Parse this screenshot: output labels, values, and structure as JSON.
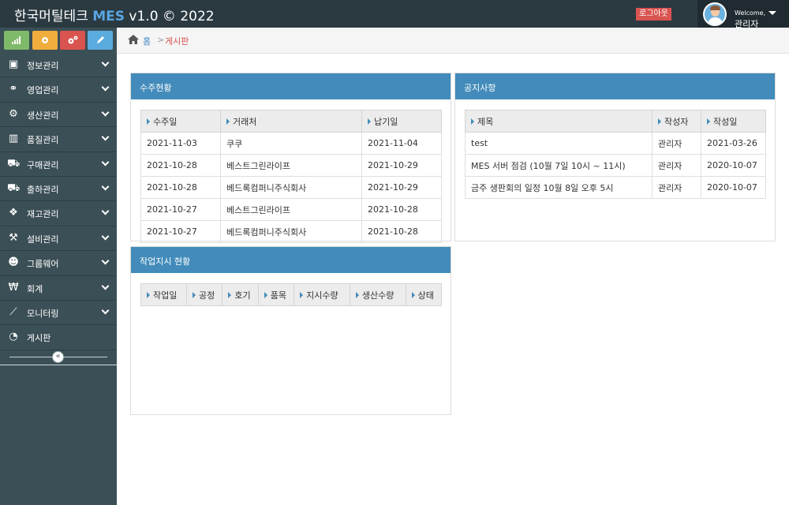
{
  "header": {
    "brand_prefix": "한국머틸테크 ",
    "brand_mes": "MES",
    "brand_suffix": " v1.0 © 2022",
    "logout_label": "로그아웃",
    "welcome": "Welcome,",
    "username": "관리자"
  },
  "shortcuts": [
    {
      "icon": "signal-icon",
      "color": "#7fba6a"
    },
    {
      "icon": "gear-icon",
      "color": "#f0ad3c"
    },
    {
      "icon": "cogs-icon",
      "color": "#d9534f"
    },
    {
      "icon": "pencil-icon",
      "color": "#5bacde"
    }
  ],
  "sidebar": {
    "items": [
      {
        "label": "정보관리",
        "icon": "contact-card-icon",
        "has_children": true
      },
      {
        "label": "영업관리",
        "icon": "handshake-icon",
        "has_children": true
      },
      {
        "label": "생산관리",
        "icon": "cogs-icon",
        "has_children": true
      },
      {
        "label": "품질관리",
        "icon": "barcode-icon",
        "has_children": true
      },
      {
        "label": "구매관리",
        "icon": "shopping-cart-icon",
        "has_children": true
      },
      {
        "label": "출하관리",
        "icon": "truck-icon",
        "has_children": true
      },
      {
        "label": "재고관리",
        "icon": "cubes-icon",
        "has_children": true
      },
      {
        "label": "설비관리",
        "icon": "wrench-icon",
        "has_children": true
      },
      {
        "label": "그룹웨어",
        "icon": "users-icon",
        "has_children": true
      },
      {
        "label": "회계",
        "icon": "won-icon",
        "has_children": true
      },
      {
        "label": "모니터링",
        "icon": "line-chart-icon",
        "has_children": true
      },
      {
        "label": "게시판",
        "icon": "dashboard-icon",
        "has_children": false
      }
    ],
    "collapse_glyph": "«"
  },
  "breadcrumb": {
    "home": "홈",
    "separator": ">",
    "current": "게시판"
  },
  "orders_panel": {
    "title": "수주현황",
    "columns": [
      "수주일",
      "거래처",
      "납기일"
    ],
    "rows": [
      [
        "2021-11-03",
        "쿠쿠",
        "2021-11-04"
      ],
      [
        "2021-10-28",
        "베스트그린라이프",
        "2021-10-29"
      ],
      [
        "2021-10-28",
        "베드록컴퍼니주식회사",
        "2021-10-29"
      ],
      [
        "2021-10-27",
        "베스트그린라이프",
        "2021-10-28"
      ],
      [
        "2021-10-27",
        "베드록컴퍼니주식회사",
        "2021-10-28"
      ]
    ]
  },
  "notice_panel": {
    "title": "공지사항",
    "columns": [
      "제목",
      "작성자",
      "작성일"
    ],
    "rows": [
      [
        "test",
        "관리자",
        "2021-03-26"
      ],
      [
        "MES 서버 점검 (10월 7일 10시 ~ 11시)",
        "관리자",
        "2020-10-07"
      ],
      [
        "금주 생판회의 일정 10월 8일 오후 5시",
        "관리자",
        "2020-10-07"
      ]
    ]
  },
  "work_panel": {
    "title": "작업지시 현황",
    "columns": [
      "작업일",
      "공정",
      "호기",
      "품목",
      "지시수량",
      "생산수량",
      "상태"
    ]
  },
  "colors": {
    "topbar": "#2b3a41",
    "sidebar": "#3b4f56",
    "panel_header": "#428bba",
    "logout": "#d9534f",
    "breadcrumb_current": "#d9534f"
  }
}
